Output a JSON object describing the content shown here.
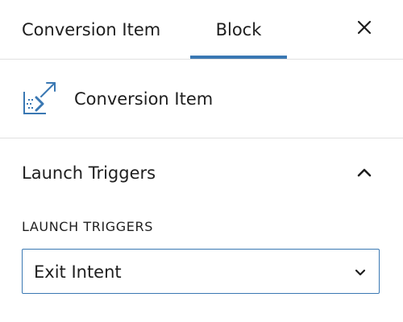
{
  "tabs": [
    {
      "label": "Conversion Item",
      "active": false
    },
    {
      "label": "Block",
      "active": true
    }
  ],
  "close_icon": "close-icon",
  "accent_color": "#3a78b3",
  "block_card": {
    "icon": "conversion-item-icon",
    "title": "Conversion Item"
  },
  "panel": {
    "title": "Launch Triggers",
    "expanded": true,
    "toggle_icon": "chevron-up-icon"
  },
  "launch_triggers_field": {
    "label": "LAUNCH TRIGGERS",
    "selected": "Exit Intent",
    "dropdown_icon": "chevron-down-icon"
  }
}
